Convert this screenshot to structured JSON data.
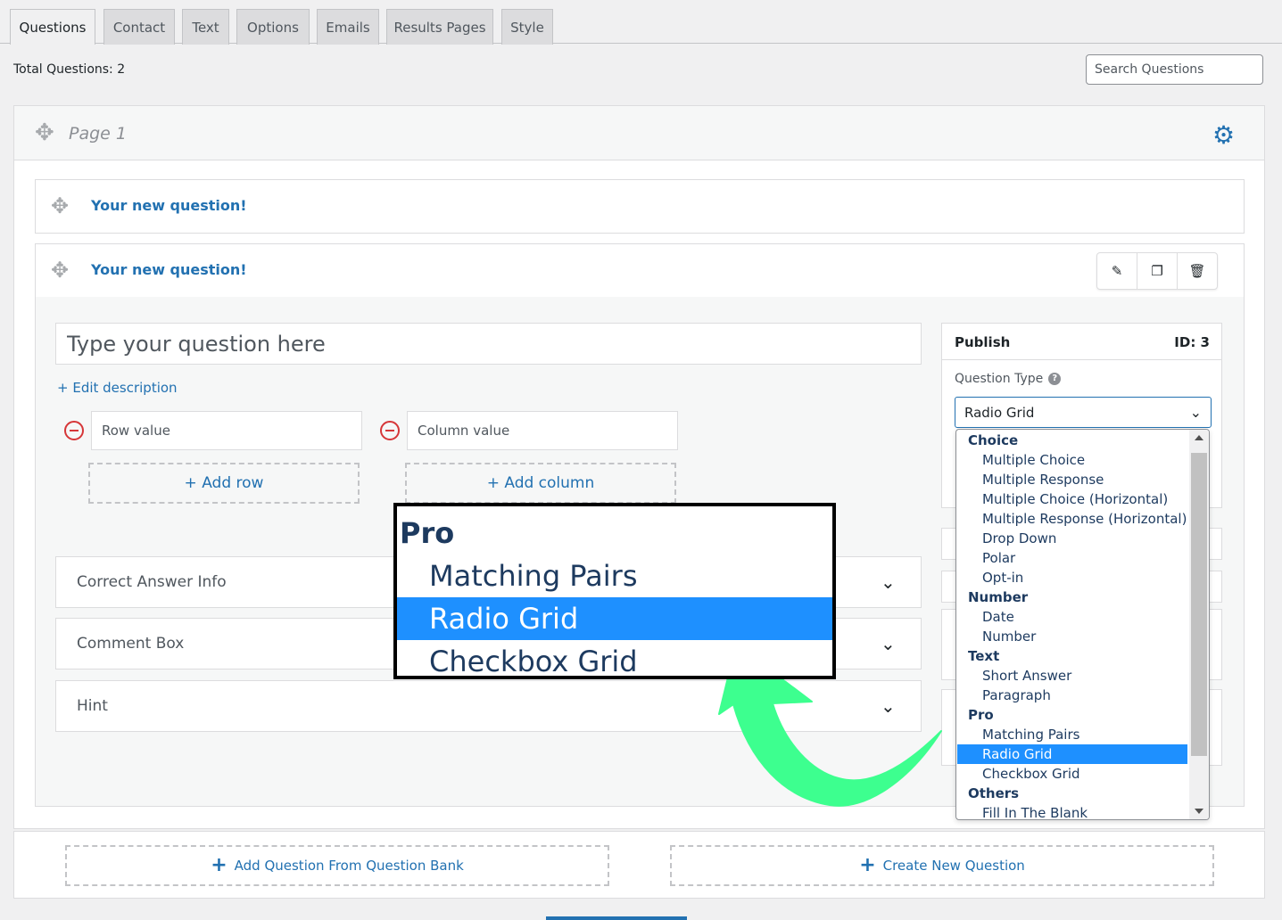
{
  "tabs": [
    {
      "label": "Questions",
      "active": true
    },
    {
      "label": "Contact"
    },
    {
      "label": "Text"
    },
    {
      "label": "Options"
    },
    {
      "label": "Emails"
    },
    {
      "label": "Results Pages"
    },
    {
      "label": "Style"
    }
  ],
  "total_questions": "Total Questions: 2",
  "search": {
    "placeholder": "Search Questions"
  },
  "page": {
    "title": "Page 1",
    "questions": [
      {
        "title": "Your new question!"
      },
      {
        "title": "Your new question!"
      }
    ]
  },
  "editor": {
    "question_placeholder": "Type your question here",
    "edit_description": "+ Edit description",
    "row_placeholder": "Row value",
    "column_placeholder": "Column value",
    "add_row": "+ Add row",
    "add_column": "+ Add column",
    "accordions": [
      {
        "label": "Correct Answer Info"
      },
      {
        "label": "Comment Box"
      },
      {
        "label": "Hint"
      }
    ]
  },
  "publish": {
    "title": "Publish",
    "id": "ID: 3",
    "question_type_label": "Question Type",
    "selected_type": "Radio Grid"
  },
  "dropdown": {
    "items": [
      {
        "text": "Choice",
        "kind": "group"
      },
      {
        "text": "Multiple Choice",
        "kind": "opt"
      },
      {
        "text": "Multiple Response",
        "kind": "opt"
      },
      {
        "text": "Multiple Choice (Horizontal)",
        "kind": "opt"
      },
      {
        "text": "Multiple Response (Horizontal)",
        "kind": "opt"
      },
      {
        "text": "Drop Down",
        "kind": "opt"
      },
      {
        "text": "Polar",
        "kind": "opt"
      },
      {
        "text": "Opt-in",
        "kind": "opt"
      },
      {
        "text": "Number",
        "kind": "group"
      },
      {
        "text": "Date",
        "kind": "opt"
      },
      {
        "text": "Number",
        "kind": "opt"
      },
      {
        "text": "Text",
        "kind": "group"
      },
      {
        "text": "Short Answer",
        "kind": "opt"
      },
      {
        "text": "Paragraph",
        "kind": "opt"
      },
      {
        "text": "Pro",
        "kind": "group"
      },
      {
        "text": "Matching Pairs",
        "kind": "opt"
      },
      {
        "text": "Radio Grid",
        "kind": "opt",
        "selected": true
      },
      {
        "text": "Checkbox Grid",
        "kind": "opt"
      },
      {
        "text": "Others",
        "kind": "group"
      },
      {
        "text": "Fill In The Blank",
        "kind": "opt"
      }
    ]
  },
  "zoom": {
    "items": [
      {
        "text": "Pro",
        "kind": "group"
      },
      {
        "text": "Matching Pairs",
        "kind": "opt"
      },
      {
        "text": "Radio Grid",
        "kind": "opt",
        "selected": true
      },
      {
        "text": "Checkbox Grid",
        "kind": "opt"
      }
    ]
  },
  "bottom": {
    "add_from_bank": "Add Question From Question Bank",
    "create_new": "Create New Question"
  },
  "colors": {
    "accent": "#2271b1",
    "selected": "#1e90ff",
    "arrow": "#3dff8f",
    "remove": "#d63638"
  }
}
